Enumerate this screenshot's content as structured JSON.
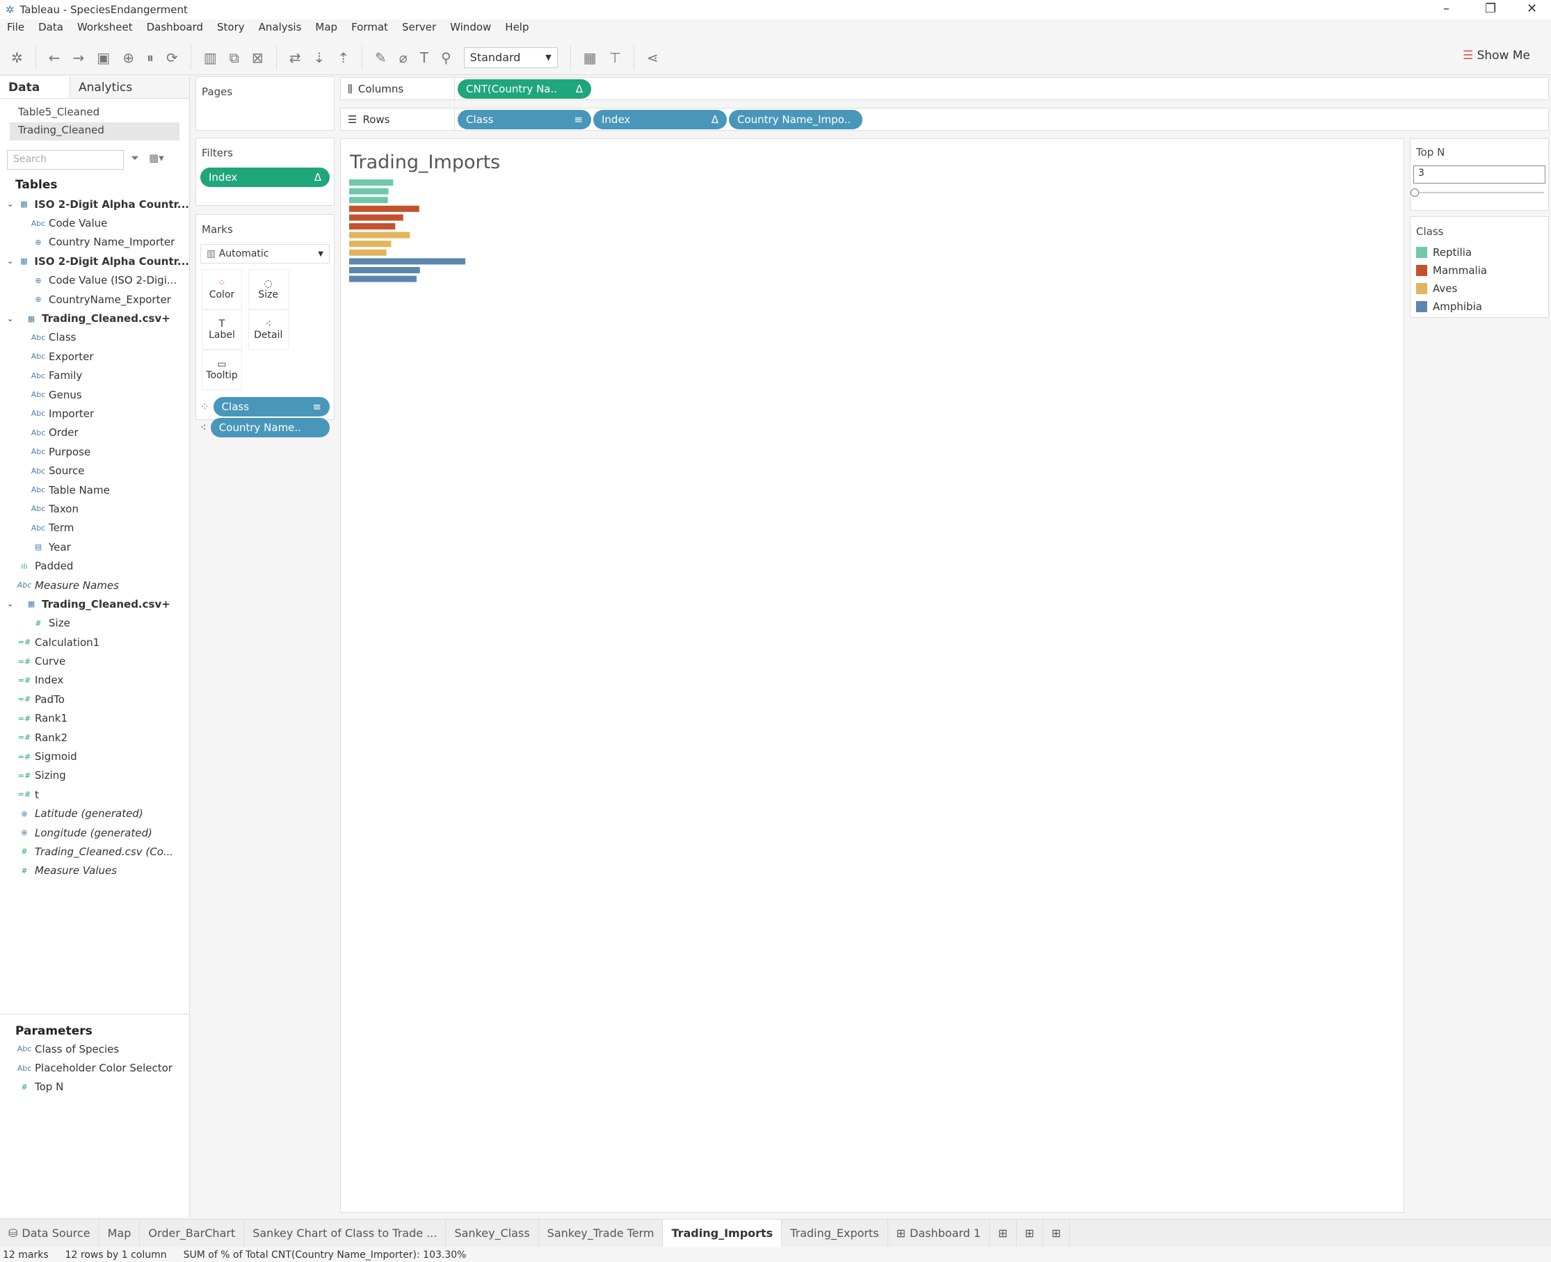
{
  "window": {
    "title": "Tableau - SpeciesEndangerment"
  },
  "menu": [
    "File",
    "Data",
    "Worksheet",
    "Dashboard",
    "Story",
    "Analysis",
    "Map",
    "Format",
    "Server",
    "Window",
    "Help"
  ],
  "toolbar": {
    "fit_select": "Standard",
    "show_me": "Show Me"
  },
  "left": {
    "tab_data": "Data",
    "tab_analytics": "Analytics",
    "datasources": [
      "Table5_Cleaned",
      "Trading_Cleaned"
    ],
    "search_placeholder": "Search",
    "tables_header": "Tables",
    "fields": [
      {
        "label": "ISO 2-Digit Alpha Countr...",
        "icon": "table",
        "level": "hdr"
      },
      {
        "label": "Code Value",
        "icon": "Abc",
        "level": "l2"
      },
      {
        "label": "Country Name_Importer",
        "icon": "globe",
        "level": "l2"
      },
      {
        "label": "ISO 2-Digit Alpha Countr...",
        "icon": "table",
        "level": "hdr"
      },
      {
        "label": "Code Value (ISO 2-Digi...",
        "icon": "globe",
        "level": "l2"
      },
      {
        "label": "CountryName_Exporter",
        "icon": "globe",
        "level": "l2"
      },
      {
        "label": "Trading_Cleaned.csv+",
        "icon": "table",
        "level": "hdr"
      },
      {
        "label": "Class",
        "icon": "Abc",
        "level": "l2"
      },
      {
        "label": "Exporter",
        "icon": "Abc",
        "level": "l2"
      },
      {
        "label": "Family",
        "icon": "Abc",
        "level": "l2"
      },
      {
        "label": "Genus",
        "icon": "Abc",
        "level": "l2"
      },
      {
        "label": "Importer",
        "icon": "Abc",
        "level": "l2"
      },
      {
        "label": "Order",
        "icon": "Abc",
        "level": "l2"
      },
      {
        "label": "Purpose",
        "icon": "Abc",
        "level": "l2"
      },
      {
        "label": "Source",
        "icon": "Abc",
        "level": "l2"
      },
      {
        "label": "Table Name",
        "icon": "Abc",
        "level": "l2"
      },
      {
        "label": "Taxon",
        "icon": "Abc",
        "level": "l2"
      },
      {
        "label": "Term",
        "icon": "Abc",
        "level": "l2"
      },
      {
        "label": "Year",
        "icon": "calendar",
        "level": "l2"
      },
      {
        "label": "Padded",
        "icon": "bin",
        "level": "l1"
      },
      {
        "label": "Measure Names",
        "icon": "Abc",
        "level": "l1",
        "italic": true
      },
      {
        "label": "Trading_Cleaned.csv+",
        "icon": "table",
        "level": "hdr"
      },
      {
        "label": "Size",
        "icon": "#",
        "level": "l2"
      },
      {
        "label": "Calculation1",
        "icon": "=#",
        "level": "l1"
      },
      {
        "label": "Curve",
        "icon": "=#",
        "level": "l1"
      },
      {
        "label": "Index",
        "icon": "=#",
        "level": "l1"
      },
      {
        "label": "PadTo",
        "icon": "=#",
        "level": "l1"
      },
      {
        "label": "Rank1",
        "icon": "=#",
        "level": "l1"
      },
      {
        "label": "Rank2",
        "icon": "=#",
        "level": "l1"
      },
      {
        "label": "Sigmoid",
        "icon": "=#",
        "level": "l1"
      },
      {
        "label": "Sizing",
        "icon": "=#",
        "level": "l1"
      },
      {
        "label": "t",
        "icon": "=#",
        "level": "l1"
      },
      {
        "label": "Latitude (generated)",
        "icon": "globe",
        "level": "l1",
        "italic": true
      },
      {
        "label": "Longitude (generated)",
        "icon": "globe",
        "level": "l1",
        "italic": true
      },
      {
        "label": "Trading_Cleaned.csv (Co...",
        "icon": "#",
        "level": "l1",
        "italic": true
      },
      {
        "label": "Measure Values",
        "icon": "#",
        "level": "l1",
        "italic": true
      }
    ],
    "parameters_header": "Parameters",
    "parameters": [
      {
        "label": "Class of Species",
        "icon": "Abc"
      },
      {
        "label": "Placeholder Color Selector",
        "icon": "Abc"
      },
      {
        "label": "Top N",
        "icon": "#"
      }
    ]
  },
  "pages": {
    "title": "Pages"
  },
  "filters": {
    "title": "Filters",
    "pills": [
      "Index"
    ]
  },
  "marks": {
    "title": "Marks",
    "type": "Automatic",
    "buttons": [
      "Color",
      "Size",
      "Label",
      "Detail",
      "Tooltip"
    ],
    "pills": [
      "Class",
      "Country Name.."
    ]
  },
  "shelves": {
    "columns_label": "Columns",
    "columns": [
      "CNT(Country Na.."
    ],
    "rows_label": "Rows",
    "rows": [
      "Class",
      "Index",
      "Country Name_Impo.."
    ]
  },
  "view": {
    "title": "Trading_Imports"
  },
  "chart_data": {
    "type": "bar",
    "orientation": "horizontal",
    "categories_by_class": [
      "Reptilia",
      "Reptilia",
      "Reptilia",
      "Mammalia",
      "Mammalia",
      "Mammalia",
      "Aves",
      "Aves",
      "Aves",
      "Amphibia",
      "Amphibia",
      "Amphibia"
    ],
    "values": [
      6.6,
      5.9,
      5.8,
      10.5,
      8.1,
      6.9,
      9.1,
      6.3,
      5.6,
      17.4,
      10.6,
      10.1
    ]
  },
  "right": {
    "topn_title": "Top N",
    "topn_value": "3",
    "topn_slider": 0,
    "legend_title": "Class",
    "legend": [
      {
        "label": "Reptilia",
        "color": "#6fc8a9"
      },
      {
        "label": "Mammalia",
        "color": "#c2522e"
      },
      {
        "label": "Aves",
        "color": "#e2b45e"
      },
      {
        "label": "Amphibia",
        "color": "#5b86ae"
      }
    ]
  },
  "sheet_tabs": [
    {
      "label": "Data Source"
    },
    {
      "label": "Map"
    },
    {
      "label": "Order_BarChart"
    },
    {
      "label": "Sankey Chart of Class to Trade ..."
    },
    {
      "label": "Sankey_Class"
    },
    {
      "label": "Sankey_Trade Term"
    },
    {
      "label": "Trading_Imports",
      "active": true
    },
    {
      "label": "Trading_Exports"
    },
    {
      "label": "Dashboard 1"
    }
  ],
  "status": {
    "marks": "12 marks",
    "dims": "12 rows by 1 column",
    "sum": "SUM of % of Total CNT(Country Name_Importer): 103.30%"
  }
}
